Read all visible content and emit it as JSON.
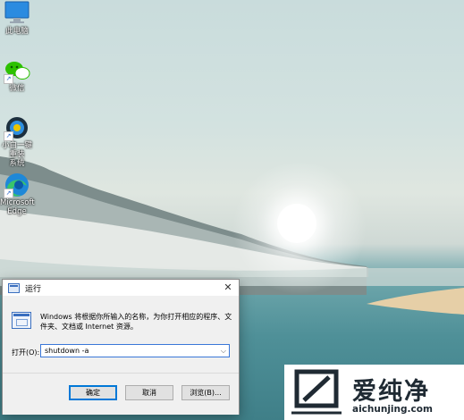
{
  "desktop": {
    "icons": [
      {
        "label": "此电脑",
        "icon": "computer-icon"
      },
      {
        "label": "微信",
        "icon": "wechat-icon"
      },
      {
        "label": "一键重装系统",
        "label_line1": "小白一键重装",
        "label_line2": "系统",
        "icon": "reinstall-tool-icon"
      },
      {
        "label_line1": "Microsoft",
        "label_line2": "Edge",
        "icon": "edge-icon"
      }
    ],
    "shortcut_glyph": "↗"
  },
  "run_dialog": {
    "title": "运行",
    "description": "Windows 将根据你所输入的名称，为你打开相应的程序、文件夹、文档或 Internet 资源。",
    "open_label": "打开(O):",
    "input_value": "shutdown -a",
    "dropdown_glyph": "⌵",
    "ok_label": "确定",
    "cancel_label": "取消",
    "browse_label": "浏览(B)...",
    "close_glyph": "✕"
  },
  "watermark": {
    "brand_cn": "爱纯净",
    "url": "aichunjing.com"
  },
  "colors": {
    "accent": "#0078d7",
    "dialog_bg": "#f0f0f0",
    "watermark_text": "#1f2a33"
  }
}
